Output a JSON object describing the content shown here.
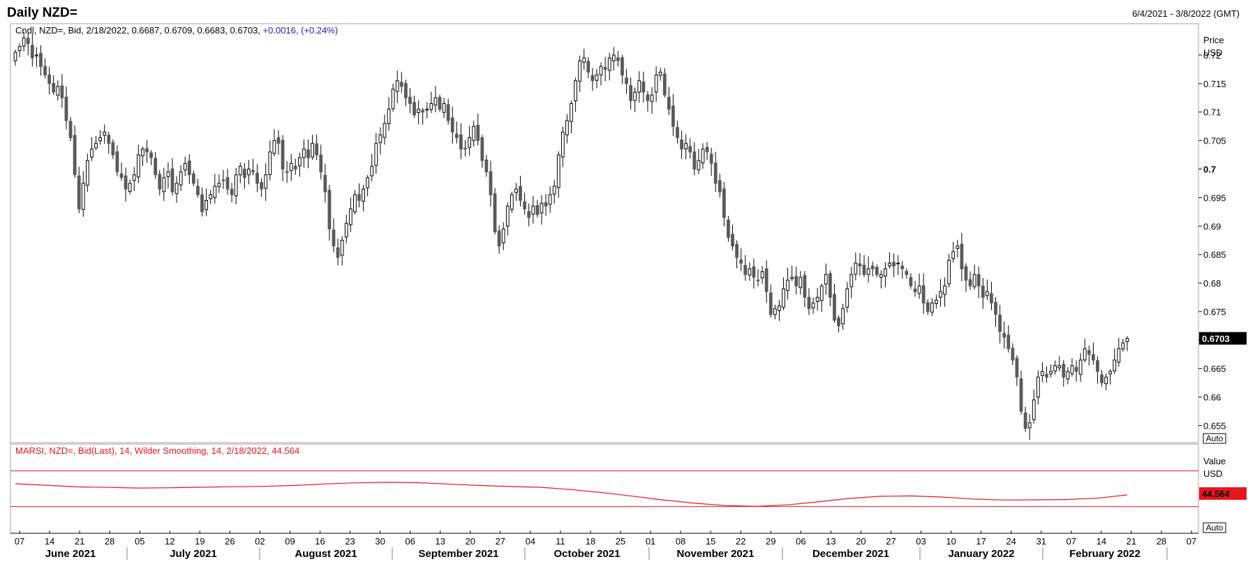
{
  "header": {
    "title": "Daily NZD=",
    "date_range": "6/4/2021 - 3/8/2022 (GMT)"
  },
  "price_panel": {
    "legend_prefix": "Cndl, NZD=, Bid, 2/18/2022, 0.6687, 0.6709, 0.6683, 0.6703,",
    "legend_change": "+0.0016, (+0.24%)",
    "axis_title_1": "Price",
    "axis_title_2": "USD",
    "last_value": "0.6703",
    "auto_label": "Auto",
    "colors": {
      "frame": "#a0a0a8",
      "down_body": "#5a5a5a",
      "up_body": "#ffffff",
      "change": "#1a1acc",
      "last_bg": "#000000"
    }
  },
  "rsi_panel": {
    "legend": "MARSI, NZD=, Bid(Last),  14, Wilder Smoothing, 14, 2/18/2022, 44.564",
    "axis_title_1": "Value",
    "axis_title_2": "USD",
    "last_value": "44.564",
    "auto_label": "Auto",
    "colors": {
      "line": "#e8141e",
      "last_bg": "#e8141e"
    }
  },
  "chart_data": [
    {
      "type": "candlestick",
      "title": "Daily NZD=",
      "ylabel": "Price USD",
      "ylim": [
        0.652,
        0.7255
      ],
      "y_ticks": [
        "0.72",
        "0.715",
        "0.71",
        "0.705",
        "0.7",
        "0.695",
        "0.69",
        "0.685",
        "0.68",
        "0.675",
        "0.67",
        "0.665",
        "0.66",
        "0.655"
      ],
      "x_ticks": [
        "07",
        "14",
        "21",
        "28",
        "05",
        "12",
        "19",
        "26",
        "02",
        "09",
        "16",
        "23",
        "30",
        "06",
        "13",
        "20",
        "27",
        "04",
        "11",
        "18",
        "25",
        "01",
        "08",
        "15",
        "22",
        "29",
        "06",
        "13",
        "20",
        "27",
        "03",
        "10",
        "17",
        "24",
        "31",
        "07",
        "14",
        "21",
        "28",
        "07"
      ],
      "x_months": [
        "June 2021",
        "July 2021",
        "August 2021",
        "September 2021",
        "October 2021",
        "November 2021",
        "December 2021",
        "January 2022",
        "February 2022"
      ],
      "closes": [
        0.7205,
        0.7215,
        0.723,
        0.722,
        0.7195,
        0.72,
        0.718,
        0.7165,
        0.715,
        0.7135,
        0.7145,
        0.7125,
        0.7085,
        0.7055,
        0.699,
        0.693,
        0.6975,
        0.7015,
        0.7035,
        0.7045,
        0.7055,
        0.7065,
        0.7045,
        0.7025,
        0.6995,
        0.6985,
        0.6965,
        0.6975,
        0.699,
        0.7025,
        0.7035,
        0.703,
        0.702,
        0.699,
        0.6965,
        0.6985,
        0.6995,
        0.696,
        0.6975,
        0.6995,
        0.701,
        0.699,
        0.6975,
        0.6955,
        0.6925,
        0.6945,
        0.6955,
        0.697,
        0.6975,
        0.698,
        0.6965,
        0.6955,
        0.699,
        0.7005,
        0.6985,
        0.7,
        0.6995,
        0.6975,
        0.6965,
        0.699,
        0.703,
        0.705,
        0.7045,
        0.7,
        0.6995,
        0.701,
        0.7,
        0.702,
        0.7035,
        0.702,
        0.7045,
        0.7025,
        0.6995,
        0.696,
        0.6895,
        0.6865,
        0.6845,
        0.6875,
        0.6905,
        0.693,
        0.6955,
        0.6945,
        0.6965,
        0.6985,
        0.7005,
        0.7045,
        0.706,
        0.708,
        0.7105,
        0.714,
        0.7155,
        0.7145,
        0.7125,
        0.7115,
        0.7095,
        0.7105,
        0.71,
        0.7105,
        0.7115,
        0.7125,
        0.7105,
        0.7115,
        0.7085,
        0.7065,
        0.7055,
        0.7035,
        0.7035,
        0.7055,
        0.7075,
        0.705,
        0.7015,
        0.6995,
        0.6955,
        0.689,
        0.6865,
        0.6895,
        0.6935,
        0.6955,
        0.6965,
        0.6945,
        0.693,
        0.6915,
        0.6935,
        0.692,
        0.694,
        0.6935,
        0.6955,
        0.697,
        0.7025,
        0.7065,
        0.7085,
        0.7115,
        0.7155,
        0.719,
        0.7195,
        0.717,
        0.7155,
        0.7165,
        0.718,
        0.7175,
        0.7195,
        0.72,
        0.719,
        0.7165,
        0.715,
        0.712,
        0.7135,
        0.7155,
        0.7135,
        0.712,
        0.713,
        0.7165,
        0.717,
        0.713,
        0.7105,
        0.7075,
        0.7055,
        0.7035,
        0.7045,
        0.703,
        0.7,
        0.7015,
        0.7035,
        0.703,
        0.701,
        0.6975,
        0.696,
        0.6915,
        0.688,
        0.6865,
        0.6845,
        0.6835,
        0.6815,
        0.6825,
        0.681,
        0.6805,
        0.682,
        0.6785,
        0.6745,
        0.6755,
        0.676,
        0.679,
        0.6805,
        0.681,
        0.6795,
        0.681,
        0.6775,
        0.6755,
        0.6765,
        0.6775,
        0.6795,
        0.6815,
        0.6775,
        0.6735,
        0.6725,
        0.6755,
        0.679,
        0.6815,
        0.6835,
        0.683,
        0.6815,
        0.6825,
        0.6825,
        0.6815,
        0.6815,
        0.6825,
        0.6835,
        0.683,
        0.6835,
        0.6825,
        0.6815,
        0.6795,
        0.6785,
        0.6795,
        0.6765,
        0.675,
        0.6765,
        0.677,
        0.6785,
        0.6795,
        0.684,
        0.6855,
        0.6865,
        0.6825,
        0.6805,
        0.6795,
        0.6815,
        0.6795,
        0.6775,
        0.6785,
        0.6765,
        0.6745,
        0.6715,
        0.6705,
        0.6685,
        0.6665,
        0.6635,
        0.6575,
        0.6545,
        0.6555,
        0.6595,
        0.6635,
        0.6645,
        0.6635,
        0.6645,
        0.6655,
        0.6655,
        0.6635,
        0.6645,
        0.6655,
        0.6645,
        0.6665,
        0.6685,
        0.6675,
        0.6665,
        0.6645,
        0.6625,
        0.6635,
        0.6645,
        0.6665,
        0.6685,
        0.6695,
        0.6703
      ],
      "last_close": 0.6703
    },
    {
      "type": "line",
      "title": "MARSI, NZD=, Bid(Last),  14, Wilder Smoothing, 14",
      "ylabel": "Value USD",
      "ylim": [
        0,
        100
      ],
      "bands": [
        70,
        30
      ],
      "values": [
        55.5,
        53.8,
        52.0,
        51.4,
        50.7,
        51.0,
        51.6,
        52.2,
        52.6,
        53.6,
        55.2,
        56.5,
        57.1,
        56.7,
        55.2,
        53.6,
        52.4,
        51.6,
        49.0,
        45.6,
        41.6,
        37.2,
        33.7,
        31.1,
        30.2,
        31.9,
        35.2,
        39.1,
        41.5,
        41.9,
        40.6,
        38.4,
        37.3,
        37.5,
        37.8,
        39.3,
        43.0
      ],
      "last_value": 44.564
    }
  ]
}
